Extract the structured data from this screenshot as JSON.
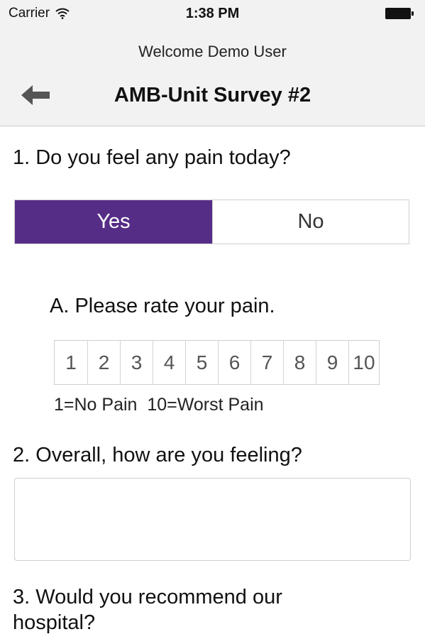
{
  "status_bar": {
    "carrier": "Carrier",
    "time": "1:38 PM"
  },
  "header": {
    "welcome": "Welcome Demo User",
    "title": "AMB-Unit Survey #2"
  },
  "questions": {
    "q1": {
      "text": "1. Do you feel any pain today?",
      "options": [
        "Yes",
        "No"
      ],
      "selected": "Yes"
    },
    "q1a": {
      "text": "A. Please rate your pain.",
      "scale": [
        "1",
        "2",
        "3",
        "4",
        "5",
        "6",
        "7",
        "8",
        "9",
        "10"
      ],
      "note": "1=No Pain  10=Worst Pain"
    },
    "q2": {
      "text": "2. Overall, how are you feeling?",
      "value": ""
    },
    "q3": {
      "text_line1": "3. Would you recommend our",
      "text_line2": "hospital?"
    }
  },
  "colors": {
    "accent": "#552d86"
  }
}
